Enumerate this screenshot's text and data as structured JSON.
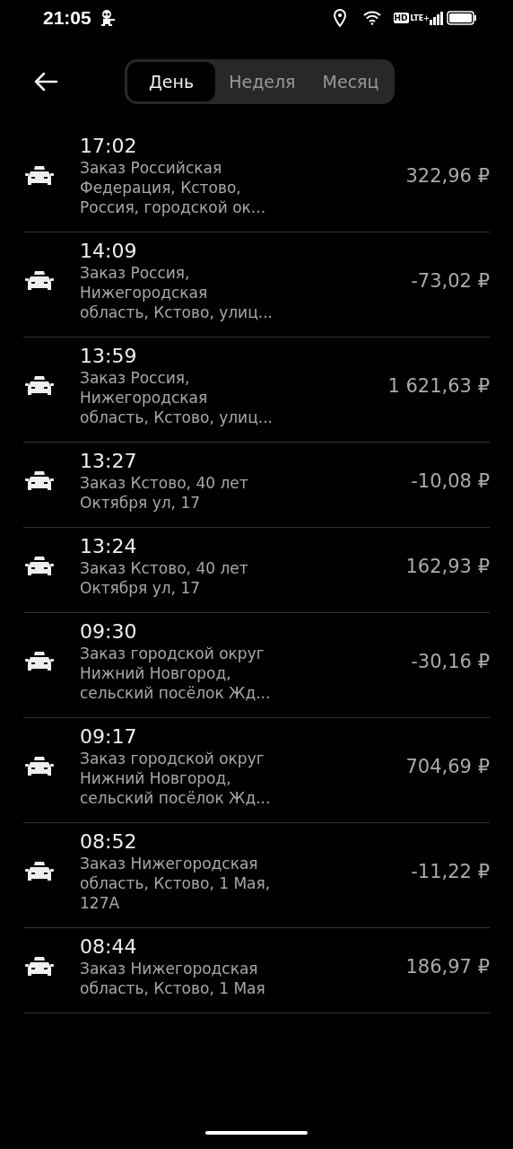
{
  "status_bar": {
    "time": "21:05",
    "hd": "HD",
    "network": "LTE+"
  },
  "tabs": [
    {
      "label": "День",
      "selected": true
    },
    {
      "label": "Неделя",
      "selected": false
    },
    {
      "label": "Месяц",
      "selected": false
    }
  ],
  "orders": [
    {
      "time": "17:02",
      "description": "Заказ Российская\nФедерация, Кстово,\nРоссия, городской ок...",
      "amount": "322,96 ₽"
    },
    {
      "time": "14:09",
      "description": "Заказ Россия,\nНижегородская\nобласть, Кстово, улиц...",
      "amount": "-73,02 ₽"
    },
    {
      "time": "13:59",
      "description": "Заказ Россия,\nНижегородская\nобласть, Кстово, улиц...",
      "amount": "1 621,63 ₽"
    },
    {
      "time": "13:27",
      "description": "Заказ Кстово, 40 лет\nОктября ул, 17",
      "amount": "-10,08 ₽"
    },
    {
      "time": "13:24",
      "description": "Заказ Кстово, 40 лет\nОктября ул, 17",
      "amount": "162,93 ₽"
    },
    {
      "time": "09:30",
      "description": "Заказ городской округ\nНижний Новгород,\nсельский посёлок Жд...",
      "amount": "-30,16 ₽"
    },
    {
      "time": "09:17",
      "description": "Заказ городской округ\nНижний Новгород,\nсельский посёлок Жд...",
      "amount": "704,69 ₽"
    },
    {
      "time": "08:52",
      "description": "Заказ Нижегородская\nобласть, Кстово, 1 Мая,\n127А",
      "amount": "-11,22 ₽"
    },
    {
      "time": "08:44",
      "description": "Заказ Нижегородская\nобласть, Кстово, 1 Мая",
      "amount": "186,97 ₽"
    }
  ]
}
